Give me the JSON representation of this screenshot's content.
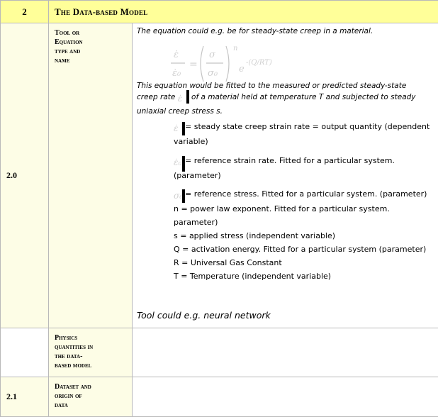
{
  "header": {
    "number": "2",
    "title": "The Data-based Model"
  },
  "section_2_0": {
    "number": "2.0",
    "label_lines": [
      "Tool or",
      "Equation",
      "type and",
      "name"
    ],
    "intro": "The equation could e.g. be for steady-state creep in a material.",
    "equation": {
      "exponent": "n",
      "exp_term": "-(Q/RT)"
    },
    "fit_text_1": "This equation would be fitted to the measured or predicted steady-state",
    "fit_text_2a": "creep rate",
    "fit_text_2b": "of a material held at temperature T and subjected to steady",
    "fit_text_3": "uniaxial creep stress s.",
    "vars": [
      {
        "text": "= steady state creep strain rate = output quantity (dependent variable)"
      },
      {
        "text": "= reference strain rate. Fitted for a particular system. (parameter)"
      },
      {
        "text": "= reference stress.  Fitted for a particular system. (parameter)"
      },
      {
        "text": "n = power law exponent.  Fitted for a particular system. parameter)"
      },
      {
        "text": "s = applied stress (independent variable)"
      },
      {
        "text": "Q = activation energy.  Fitted for a particular system (parameter)"
      },
      {
        "text": "R = Universal Gas Constant"
      },
      {
        "text": "T = Temperature (independent variable)"
      }
    ],
    "tool_note": "Tool could e.g. neural network"
  },
  "physics_row": {
    "label_lines": [
      "Physics",
      "quantities in",
      "the data-",
      "based model"
    ]
  },
  "section_2_1": {
    "number": "2.1",
    "label_lines": [
      "Dataset and",
      "origin of",
      "data"
    ]
  }
}
